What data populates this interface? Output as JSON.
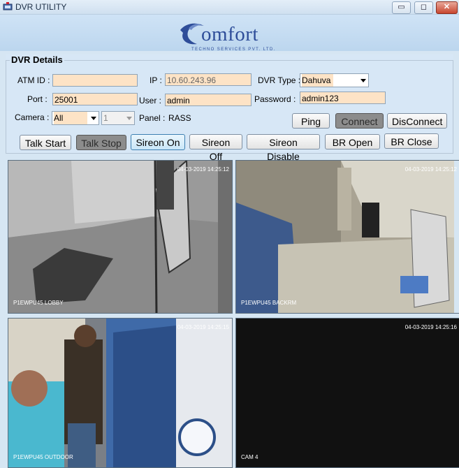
{
  "window": {
    "title": "DVR UTILITY",
    "minimize": "▭",
    "maximize": "◻",
    "close": "✕"
  },
  "logo": {
    "word": "omfort",
    "tagline": "TECHNO SERVICES PVT. LTD."
  },
  "details": {
    "title": "DVR Details",
    "atm_label": "ATM ID :",
    "atm_value": "",
    "ip_label": "IP :",
    "ip_value": "10.60.243.96",
    "dvr_type_label": "DVR Type :",
    "dvr_type_value": "Dahuva",
    "port_label": "Port :",
    "port_value": "25001",
    "user_label": "User :",
    "user_value": "admin",
    "password_label": "Password :",
    "password_value": "admin123",
    "camera_label": "Camera :",
    "camera_value": "All",
    "channel_value": "1",
    "panel_label": "Panel :",
    "panel_value": "RASS"
  },
  "buttons": {
    "ping": "Ping",
    "connect": "Connect",
    "disconnect": "DisConnect",
    "talk_start": "Talk Start",
    "talk_stop": "Talk Stop",
    "sireon_on": "Sireon On",
    "sireon_off": "Sireon Off",
    "sireon_disable": "Sireon Disable",
    "br_open": "BR Open",
    "br_close": "BR Close"
  },
  "cameras": [
    {
      "name": "P1EWPU45 LOBBY",
      "timestamp": "04-03-2019 14:25:12"
    },
    {
      "name": "P1EWPU45 BACKRM",
      "timestamp": "04-03-2019 14:25:12"
    },
    {
      "name": "P1EWPU45 OUTDOOR",
      "timestamp": "04-03-2019 14:25:15"
    },
    {
      "name": "CAM 4",
      "timestamp": "04-03-2019 14:25:16"
    }
  ],
  "colors": {
    "field_bg": "#fde3c6",
    "window_bg": "#d6e6f3",
    "brand": "#2e4d99"
  }
}
